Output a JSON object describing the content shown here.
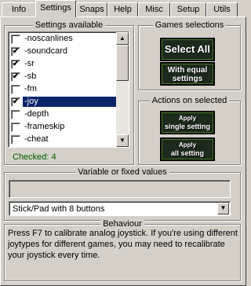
{
  "tabs": [
    {
      "label": "Info"
    },
    {
      "label": "Settings"
    },
    {
      "label": "Snaps"
    },
    {
      "label": "Help"
    },
    {
      "label": "Misc"
    },
    {
      "label": "Setup"
    },
    {
      "label": "Utils"
    }
  ],
  "settings_available": {
    "title": "Settings available",
    "items": [
      {
        "label": "-noscanlines",
        "checked": false
      },
      {
        "label": "-soundcard",
        "checked": true
      },
      {
        "label": "-sr",
        "checked": true
      },
      {
        "label": "-sb",
        "checked": true
      },
      {
        "label": "-fm",
        "checked": false
      },
      {
        "label": "-joy",
        "checked": true,
        "selected": true
      },
      {
        "label": "-depth",
        "checked": false
      },
      {
        "label": "-frameskip",
        "checked": false
      },
      {
        "label": "-cheat",
        "checked": false
      }
    ],
    "checked_text": "Checked: 4"
  },
  "games_selections": {
    "title": "Games selections",
    "select_all": "Select All",
    "with_equal_line1": "With equal",
    "with_equal_line2": "settings"
  },
  "actions_on_selected": {
    "title": "Actions on selected",
    "apply_label": "Apply",
    "single_setting": "single setting",
    "apply2_label": "Apply",
    "all_setting": "all setting"
  },
  "variable_values": {
    "title": "Variable or fixed values",
    "text_value": "",
    "combo_value": "Stick/Pad with 8 buttons"
  },
  "behaviour": {
    "title": "Behaviour",
    "text": "Press F7 to calibrate analog joystick. If you're using different joytypes for different games, you may need to recalibrate your joystick every time."
  }
}
